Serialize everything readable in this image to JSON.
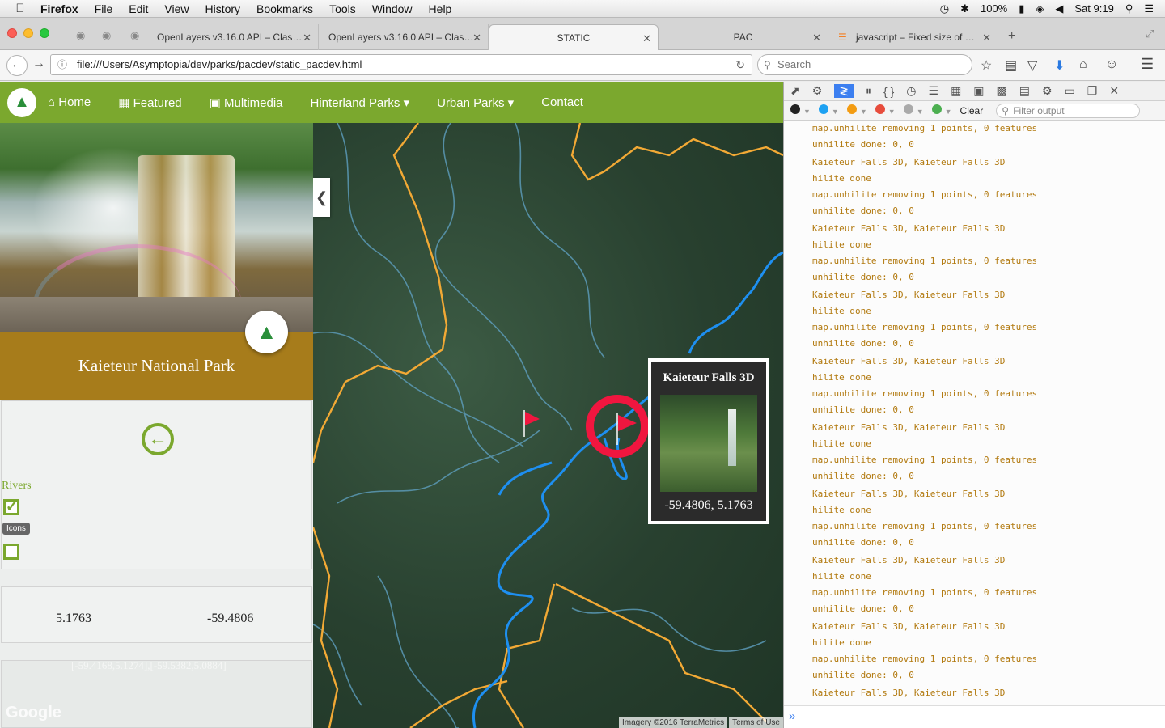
{
  "menubar": {
    "app": "Firefox",
    "items": [
      "File",
      "Edit",
      "View",
      "History",
      "Bookmarks",
      "Tools",
      "Window",
      "Help"
    ],
    "battery": "100%",
    "clock": "Sat 9:19"
  },
  "tabs": [
    {
      "label": "OpenLayers v3.16.0 API – Clas…"
    },
    {
      "label": "OpenLayers v3.16.0 API – Clas…"
    },
    {
      "label": "STATIC"
    },
    {
      "label": "PAC"
    },
    {
      "label": "javascript – Fixed size of …"
    }
  ],
  "navbar": {
    "url": "file:///Users/Asymptopia/dev/parks/pacdev/static_pacdev.html",
    "search_placeholder": "Search"
  },
  "site_nav": {
    "home": "Home",
    "featured": "Featured",
    "multimedia": "Multimedia",
    "hinterland": "Hinterland Parks",
    "urban": "Urban Parks",
    "contact": "Contact"
  },
  "park": {
    "title": "Kaieteur National Park"
  },
  "layers": {
    "rivers_label": "Rivers",
    "rivers_checked": true,
    "icons_tooltip": "Icons",
    "icons_checked": false
  },
  "coords": {
    "lat": "5.1763",
    "lon": "-59.4806"
  },
  "bbox_text": "[-59.4168,5.1274],[-59.5382,5.0884]",
  "google_logo": "Google",
  "popup": {
    "title": "Kaieteur Falls 3D",
    "coords": "-59.4806, 5.1763"
  },
  "map_attribution": {
    "imagery": "Imagery ©2016 TerraMetrics",
    "terms": "Terms of Use"
  },
  "devtools": {
    "clear_label": "Clear",
    "filter_placeholder": "Filter output",
    "filter_colors": [
      "#222222",
      "#1da1f2",
      "#f39c12",
      "#e74c3c",
      "#aaaaaa",
      "#4caf50"
    ],
    "console_lines": [
      "map.unhilite removing 1 points, 0 features",
      "unhilite done: 0, 0",
      "Kaieteur Falls 3D, Kaieteur Falls 3D",
      "hilite done",
      "map.unhilite removing 1 points, 0 features",
      "unhilite done: 0, 0",
      "Kaieteur Falls 3D, Kaieteur Falls 3D",
      "hilite done",
      "map.unhilite removing 1 points, 0 features",
      "unhilite done: 0, 0",
      "Kaieteur Falls 3D, Kaieteur Falls 3D",
      "hilite done",
      "map.unhilite removing 1 points, 0 features",
      "unhilite done: 0, 0",
      "Kaieteur Falls 3D, Kaieteur Falls 3D",
      "hilite done",
      "map.unhilite removing 1 points, 0 features",
      "unhilite done: 0, 0",
      "Kaieteur Falls 3D, Kaieteur Falls 3D",
      "hilite done",
      "map.unhilite removing 1 points, 0 features",
      "unhilite done: 0, 0",
      "Kaieteur Falls 3D, Kaieteur Falls 3D",
      "hilite done",
      "map.unhilite removing 1 points, 0 features",
      "unhilite done: 0, 0",
      "Kaieteur Falls 3D, Kaieteur Falls 3D",
      "hilite done",
      "map.unhilite removing 1 points, 0 features",
      "unhilite done: 0, 0",
      "Kaieteur Falls 3D, Kaieteur Falls 3D",
      "hilite done",
      "map.unhilite removing 1 points, 0 features",
      "unhilite done: 0, 0",
      "Kaieteur Falls 3D, Kaieteur Falls 3D",
      "hilite done"
    ]
  }
}
